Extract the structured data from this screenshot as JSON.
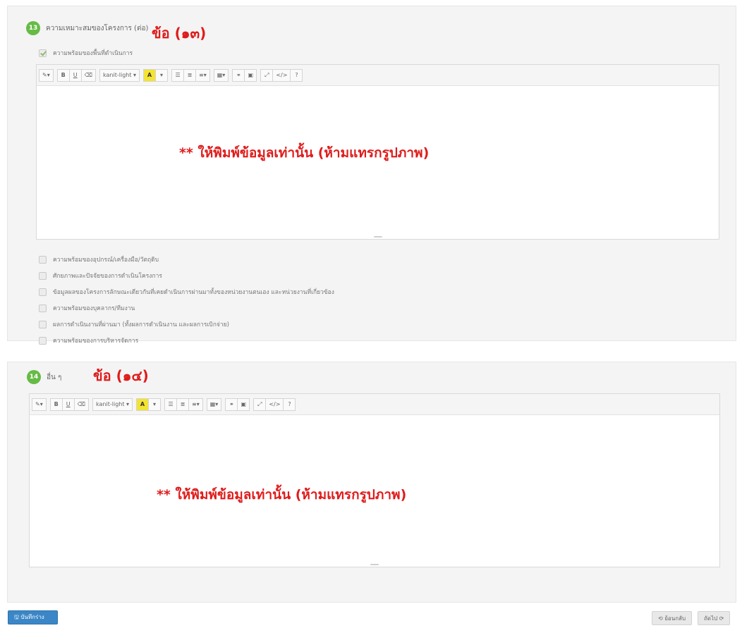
{
  "section13": {
    "number": "13",
    "title": "ความเหมาะสมของโครงการ (ต่อ)",
    "annotation": "ข้อ (๑๓)",
    "checked_item": "ความพร้อมของพื้นที่ดำเนินการ",
    "editor_note": "** ให้พิมพ์ข้อมูลเท่านั้น (ห้ามแทรกรูปภาพ)",
    "checklist": [
      "ความพร้อมของอุปกรณ์/เครื่องมือ/วัตถุดิบ",
      "ศักยภาพและปัจจัยของการดำเนินโครงการ",
      "ข้อมูลผลของโครงการลักษณะเดียวกันที่เคยดำเนินการผ่านมาทั้งของหน่วยงานตนเอง และหน่วยงานที่เกี่ยวข้อง",
      "ความพร้อมของบุคลากร/ทีมงาน",
      "ผลการดำเนินงานที่ผ่านมา (ทั้งผลการดำเนินงาน และผลการเบิกจ่าย)",
      "ความพร้อมของการบริหารจัดการ"
    ]
  },
  "section14": {
    "number": "14",
    "title": "อื่น ๆ",
    "annotation": "ข้อ (๑๔)",
    "editor_note": "** ให้พิมพ์ข้อมูลเท่านั้น (ห้ามแทรกรูปภาพ)"
  },
  "toolbar": {
    "magic": "✎▾",
    "bold": "B",
    "underline": "U",
    "eraser": "⌫",
    "font": "kanit-light ▾",
    "color": "A",
    "color_caret": "▾",
    "ul": "☰",
    "ol": "≣",
    "align": "≡▾",
    "table": "▦▾",
    "link": "⚭",
    "picture": "▣",
    "fullscreen": "⤢",
    "code": "</>",
    "help": "?"
  },
  "footer": {
    "save": "🖫 บันทึกร่าง",
    "back": "⟲ ย้อนกลับ",
    "next": "ถัดไป ⟳"
  },
  "colors": {
    "accent_green": "#66bb46",
    "annotation_red": "#e01b1b",
    "save_blue": "#3b86c6",
    "highlight_yellow": "#f3e332"
  }
}
